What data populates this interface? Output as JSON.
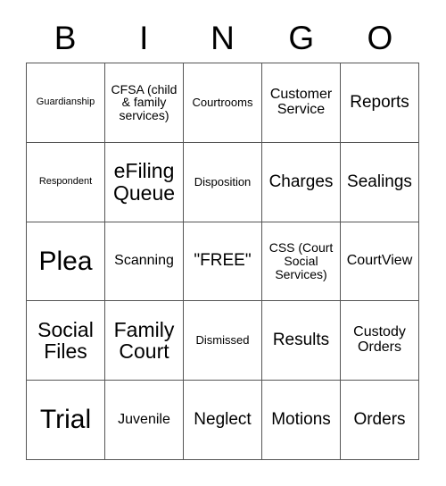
{
  "card": {
    "header_letters": [
      "B",
      "I",
      "N",
      "G",
      "O"
    ],
    "columns": 5,
    "rows": 5,
    "colors": {
      "background": "#ffffff",
      "text": "#000000",
      "border": "#555555"
    },
    "cells": [
      {
        "text": "Guardianship",
        "size": "xs",
        "column": "B",
        "row": 1
      },
      {
        "text": "CFSA (child & family services)",
        "size": "md",
        "column": "I",
        "row": 1
      },
      {
        "text": "Courtrooms",
        "size": "sm",
        "column": "N",
        "row": 1
      },
      {
        "text": "Customer Service",
        "size": "lg",
        "column": "G",
        "row": 1
      },
      {
        "text": "Reports",
        "size": "xl",
        "column": "O",
        "row": 1
      },
      {
        "text": "Respondent",
        "size": "xs",
        "column": "B",
        "row": 2
      },
      {
        "text": "eFiling Queue",
        "size": "xxl",
        "column": "I",
        "row": 2
      },
      {
        "text": "Disposition",
        "size": "sm",
        "column": "N",
        "row": 2
      },
      {
        "text": "Charges",
        "size": "xl",
        "column": "G",
        "row": 2
      },
      {
        "text": "Sealings",
        "size": "xl",
        "column": "O",
        "row": 2
      },
      {
        "text": "Plea",
        "size": "huge",
        "column": "B",
        "row": 3
      },
      {
        "text": "Scanning",
        "size": "lg",
        "column": "I",
        "row": 3
      },
      {
        "text": "\"FREE\"",
        "size": "xl",
        "column": "N",
        "row": 3
      },
      {
        "text": "CSS (Court Social Services)",
        "size": "md",
        "column": "G",
        "row": 3
      },
      {
        "text": "CourtView",
        "size": "lg",
        "column": "O",
        "row": 3
      },
      {
        "text": "Social Files",
        "size": "xxl",
        "column": "B",
        "row": 4
      },
      {
        "text": "Family Court",
        "size": "xxl",
        "column": "I",
        "row": 4
      },
      {
        "text": "Dismissed",
        "size": "sm",
        "column": "N",
        "row": 4
      },
      {
        "text": "Results",
        "size": "xl",
        "column": "G",
        "row": 4
      },
      {
        "text": "Custody Orders",
        "size": "lg",
        "column": "O",
        "row": 4
      },
      {
        "text": "Trial",
        "size": "huge",
        "column": "B",
        "row": 5
      },
      {
        "text": "Juvenile",
        "size": "lg",
        "column": "I",
        "row": 5
      },
      {
        "text": "Neglect",
        "size": "xl",
        "column": "N",
        "row": 5
      },
      {
        "text": "Motions",
        "size": "xl",
        "column": "G",
        "row": 5
      },
      {
        "text": "Orders",
        "size": "xl",
        "column": "O",
        "row": 5
      }
    ]
  }
}
